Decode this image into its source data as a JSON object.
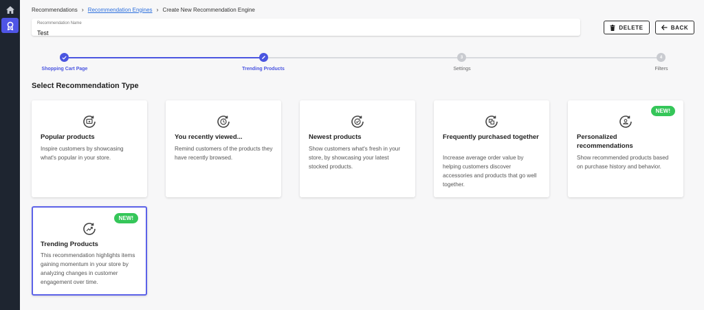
{
  "sidebar": {
    "items": [
      {
        "name": "home",
        "icon": "home-icon"
      },
      {
        "name": "recommendations",
        "icon": "ribbon-icon",
        "active": true
      }
    ],
    "accent": "#4f55e6"
  },
  "breadcrumb": {
    "root": "Recommendations",
    "parent": "Recommendation Engines",
    "current": "Create New Recommendation Engine"
  },
  "name_field": {
    "label": "Recommendation Name",
    "value": "Test"
  },
  "actions": {
    "delete_label": "DELETE",
    "back_label": "BACK"
  },
  "stepper": {
    "steps": [
      {
        "label": "Shopping Cart Page",
        "number": "1",
        "state": "completed"
      },
      {
        "label": "Trending Products",
        "number": "2",
        "state": "current"
      },
      {
        "label": "Settings",
        "number": "3",
        "state": "pending"
      },
      {
        "label": "Filters",
        "number": "4",
        "state": "pending"
      }
    ],
    "active_color": "#4a55e0"
  },
  "section_title": "Select Recommendation Type",
  "cards": [
    {
      "title": "Popular products",
      "description": "Inspire customers by showcasing what's popular in your store.",
      "icon": "chat-star-icon",
      "badge": ""
    },
    {
      "title": "You recently viewed...",
      "description": "Remind customers of the products they have recently browsed.",
      "icon": "clock-icon",
      "badge": ""
    },
    {
      "title": "Newest products",
      "description": "Show customers what's fresh in your store, by showcasing your latest stocked products.",
      "icon": "check-badge-icon",
      "badge": ""
    },
    {
      "title": "Frequently purchased together",
      "description": "Increase average order value by helping customers discover accessories and products that go well together.",
      "icon": "copy-icon",
      "badge": ""
    },
    {
      "title": "Personalized recommendations",
      "description": "Show recommended products based on purchase history and behavior.",
      "icon": "user-icon",
      "badge": "NEW!"
    },
    {
      "title": "Trending Products",
      "description": "This recommendation highlights items gaining momentum in your store by analyzing changes in customer engagement over time.",
      "icon": "trend-up-icon",
      "badge": "NEW!",
      "selected": true
    }
  ],
  "badge_color": "#35c659"
}
